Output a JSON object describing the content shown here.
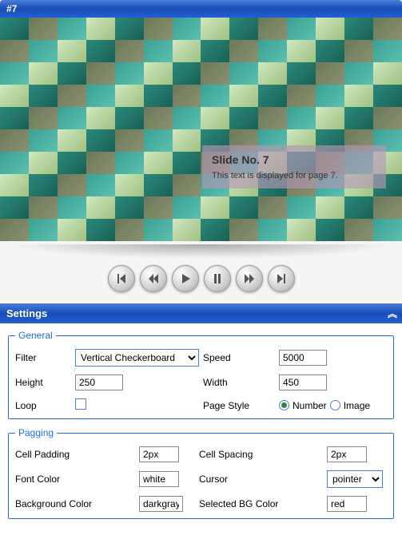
{
  "header": {
    "title": "#7"
  },
  "slide": {
    "caption_title": "Slide No. 7",
    "caption_text": "This text is displayed for page 7."
  },
  "controls": {
    "first": "first",
    "prev": "prev",
    "play": "play",
    "pause": "pause",
    "next": "next",
    "last": "last"
  },
  "settings": {
    "title": "Settings",
    "general": {
      "legend": "General",
      "filter_label": "Filter",
      "filter_value": "Vertical Checkerboard",
      "speed_label": "Speed",
      "speed_value": "5000",
      "height_label": "Height",
      "height_value": "250",
      "width_label": "Width",
      "width_value": "450",
      "loop_label": "Loop",
      "loop_checked": false,
      "pagestyle_label": "Page Style",
      "pagestyle_opt1": "Number",
      "pagestyle_opt2": "Image",
      "pagestyle_selected": "Number"
    },
    "pagging": {
      "legend": "Pagging",
      "cellpadding_label": "Cell Padding",
      "cellpadding_value": "2px",
      "cellspacing_label": "Cell Spacing",
      "cellspacing_value": "2px",
      "fontcolor_label": "Font Color",
      "fontcolor_value": "white",
      "cursor_label": "Cursor",
      "cursor_value": "pointer",
      "bgcolor_label": "Background Color",
      "bgcolor_value": "darkgray",
      "selbgcolor_label": "Selected BG Color",
      "selbgcolor_value": "red"
    }
  }
}
